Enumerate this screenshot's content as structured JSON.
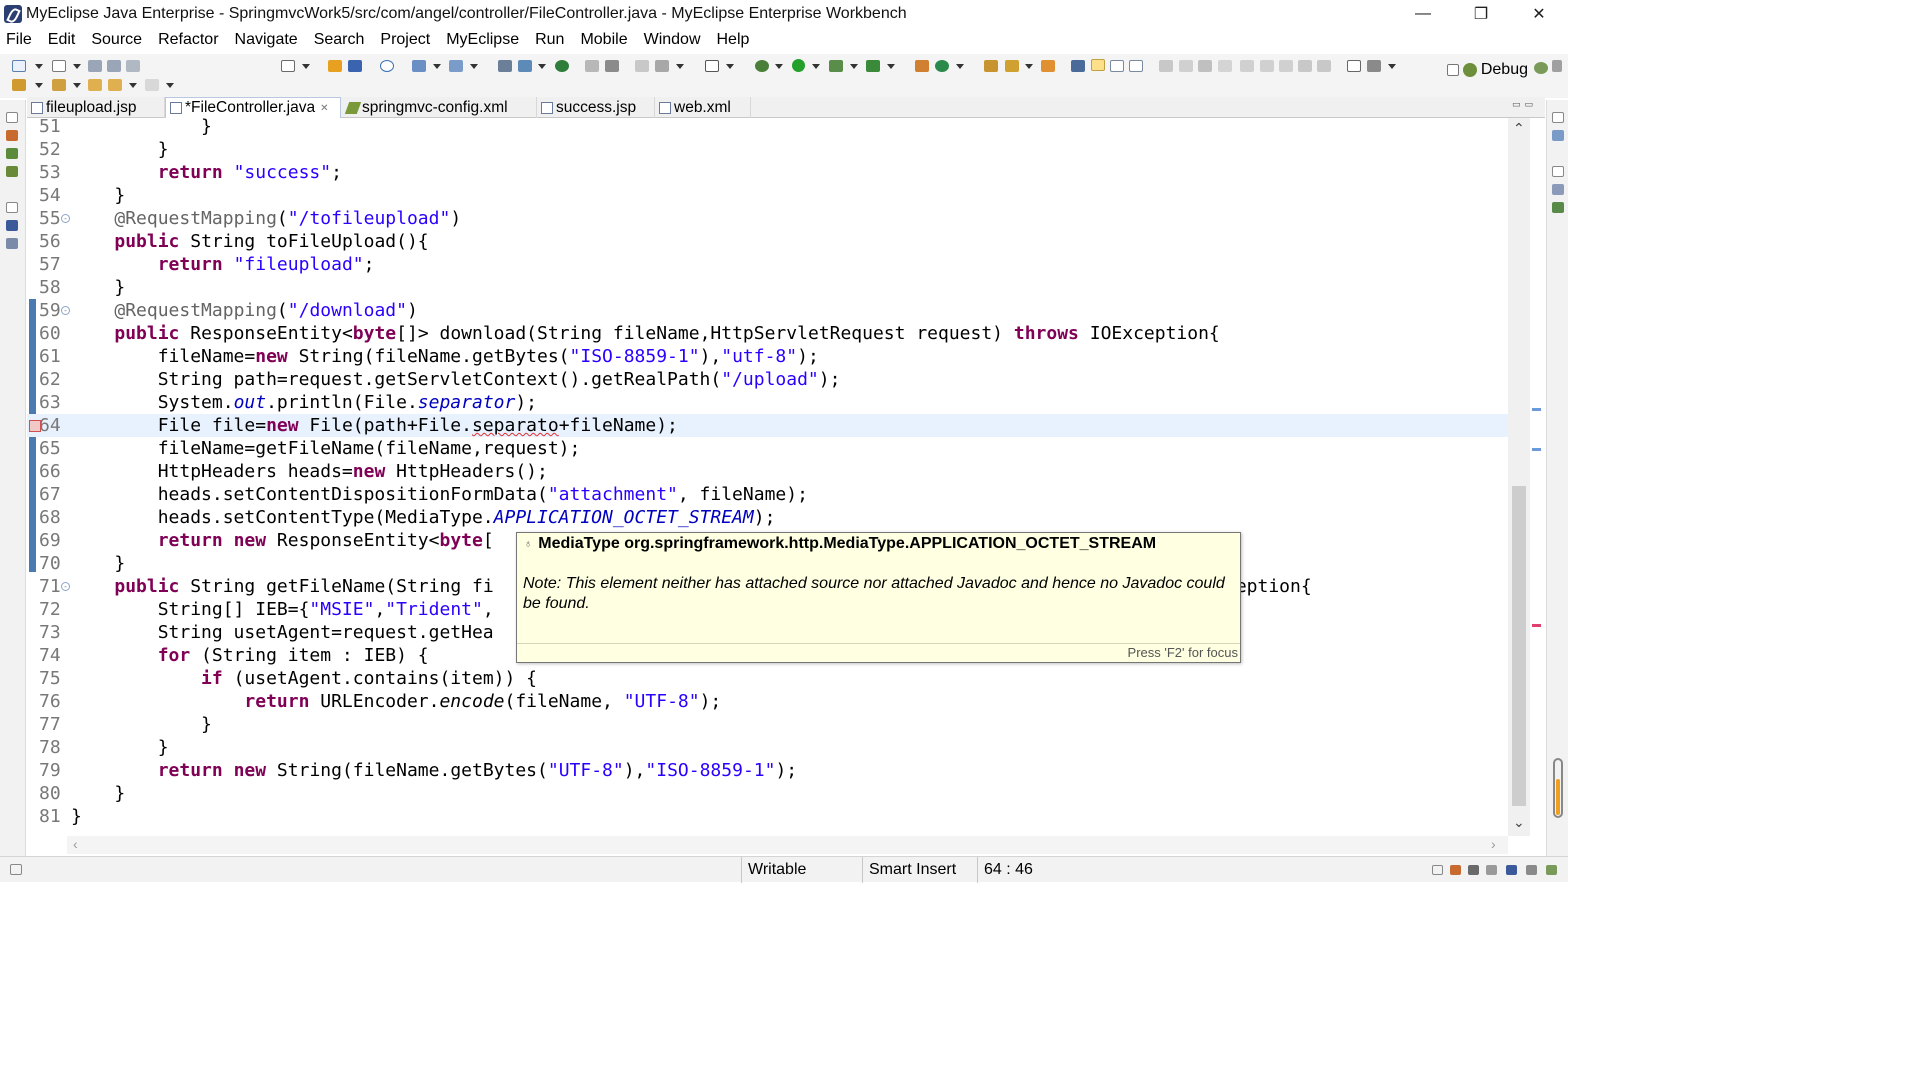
{
  "window": {
    "title": "MyEclipse Java Enterprise - SpringmvcWork5/src/com/angel/controller/FileController.java - MyEclipse Enterprise Workbench",
    "minimize": "—",
    "restore": "❐",
    "close": "✕"
  },
  "menu": [
    "File",
    "Edit",
    "Source",
    "Refactor",
    "Navigate",
    "Search",
    "Project",
    "MyEclipse",
    "Run",
    "Mobile",
    "Window",
    "Help"
  ],
  "toolbar": {
    "perspective_label": "Debug",
    "perspective_icon": "debug-perspective-icon"
  },
  "tabs": [
    {
      "label": "fileupload.jsp",
      "icon": "jsp-file-icon",
      "active": false
    },
    {
      "label": "*FileController.java",
      "icon": "java-file-icon",
      "active": true,
      "close": "✕"
    },
    {
      "label": "springmvc-config.xml",
      "icon": "xml-file-icon",
      "active": false
    },
    {
      "label": "success.jsp",
      "icon": "jsp-file-icon",
      "active": false
    },
    {
      "label": "web.xml",
      "icon": "xml-file-icon",
      "active": false
    }
  ],
  "editor": {
    "current_line": 64,
    "lines": [
      {
        "n": "51",
        "code": "            }"
      },
      {
        "n": "52",
        "code": "        }"
      },
      {
        "n": "53",
        "code": "        return \"success\";"
      },
      {
        "n": "54",
        "code": "    }"
      },
      {
        "n": "55",
        "code": "    @RequestMapping(\"/tofileupload\")",
        "fold": "⊖"
      },
      {
        "n": "56",
        "code": "    public String toFileUpload(){"
      },
      {
        "n": "57",
        "code": "        return \"fileupload\";"
      },
      {
        "n": "58",
        "code": "    }"
      },
      {
        "n": "59",
        "code": "    @RequestMapping(\"/download\")",
        "fold": "⊖"
      },
      {
        "n": "60",
        "code": "    public ResponseEntity<byte[]> download(String fileName,HttpServletRequest request) throws IOException{"
      },
      {
        "n": "61",
        "code": "        fileName=new String(fileName.getBytes(\"ISO-8859-1\"),\"utf-8\");"
      },
      {
        "n": "62",
        "code": "        String path=request.getServletContext().getRealPath(\"/upload\");"
      },
      {
        "n": "63",
        "code": "        System.out.println(File.separator);"
      },
      {
        "n": "64",
        "code": "        File file=new File(path+File.separato+fileName);"
      },
      {
        "n": "65",
        "code": "        fileName=getFileName(fileName,request);"
      },
      {
        "n": "66",
        "code": "        HttpHeaders heads=new HttpHeaders();"
      },
      {
        "n": "67",
        "code": "        heads.setContentDispositionFormData(\"attachment\", fileName);"
      },
      {
        "n": "68",
        "code": "        heads.setContentType(MediaType.APPLICATION_OCTET_STREAM);"
      },
      {
        "n": "69",
        "code": "        return new ResponseEntity<byte["
      },
      {
        "n": "70",
        "code": "    }"
      },
      {
        "n": "71",
        "code": "    public String getFileName(String fi",
        "tail": "ception{",
        "fold": "⊖"
      },
      {
        "n": "72",
        "code": "        String[] IEB={\"MSIE\",\"Trident\","
      },
      {
        "n": "73",
        "code": "        String usetAgent=request.getHea"
      },
      {
        "n": "74",
        "code": "        for (String item : IEB) {"
      },
      {
        "n": "75",
        "code": "            if (usetAgent.contains(item)) {"
      },
      {
        "n": "76",
        "code": "                return URLEncoder.encode(fileName, \"UTF-8\");"
      },
      {
        "n": "77",
        "code": "            }"
      },
      {
        "n": "78",
        "code": "        }"
      },
      {
        "n": "79",
        "code": "        return new String(fileName.getBytes(\"UTF-8\"),\"ISO-8859-1\");"
      },
      {
        "n": "80",
        "code": "    }"
      },
      {
        "n": "81",
        "code": "}"
      }
    ]
  },
  "hover": {
    "title": "MediaType org.springframework.http.MediaType.APPLICATION_OCTET_STREAM",
    "note": "Note: This element neither has attached source nor attached Javadoc and hence no Javadoc could be found.",
    "status": "Press 'F2' for focus"
  },
  "statusbar": {
    "mode": "Writable",
    "insert": "Smart Insert",
    "position": "64 : 46"
  }
}
